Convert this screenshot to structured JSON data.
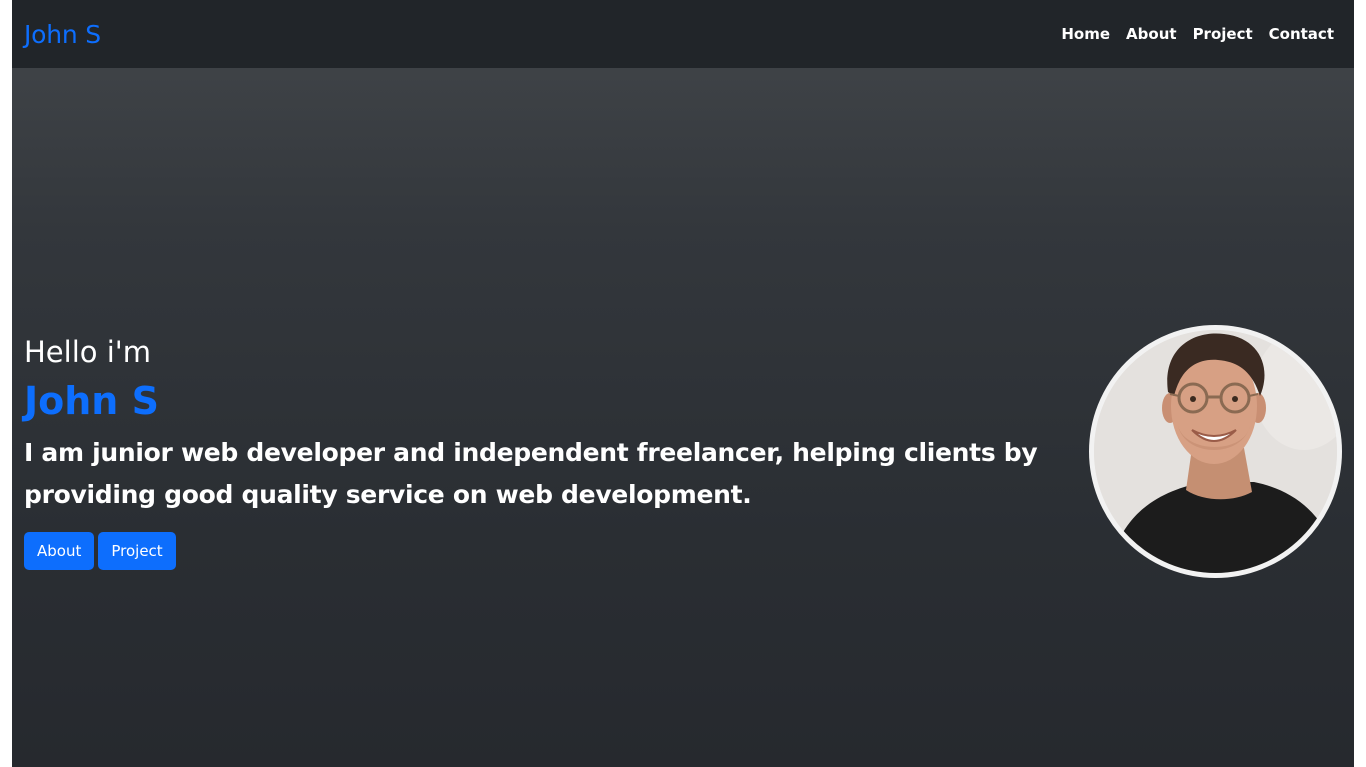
{
  "navbar": {
    "brand": "John S",
    "links": [
      "Home",
      "About",
      "Project",
      "Contact"
    ]
  },
  "hero": {
    "greeting": "Hello i'm",
    "name": "John S",
    "tagline": "I am junior web developer and independent freelancer, helping clients by providing good quality service on web development.",
    "buttons": [
      "About",
      "Project"
    ]
  },
  "colors": {
    "accent": "#0d6efd",
    "navbar_bg": "#212529",
    "text": "#ffffff"
  },
  "icons": {
    "avatar": "profile-photo-icon"
  }
}
